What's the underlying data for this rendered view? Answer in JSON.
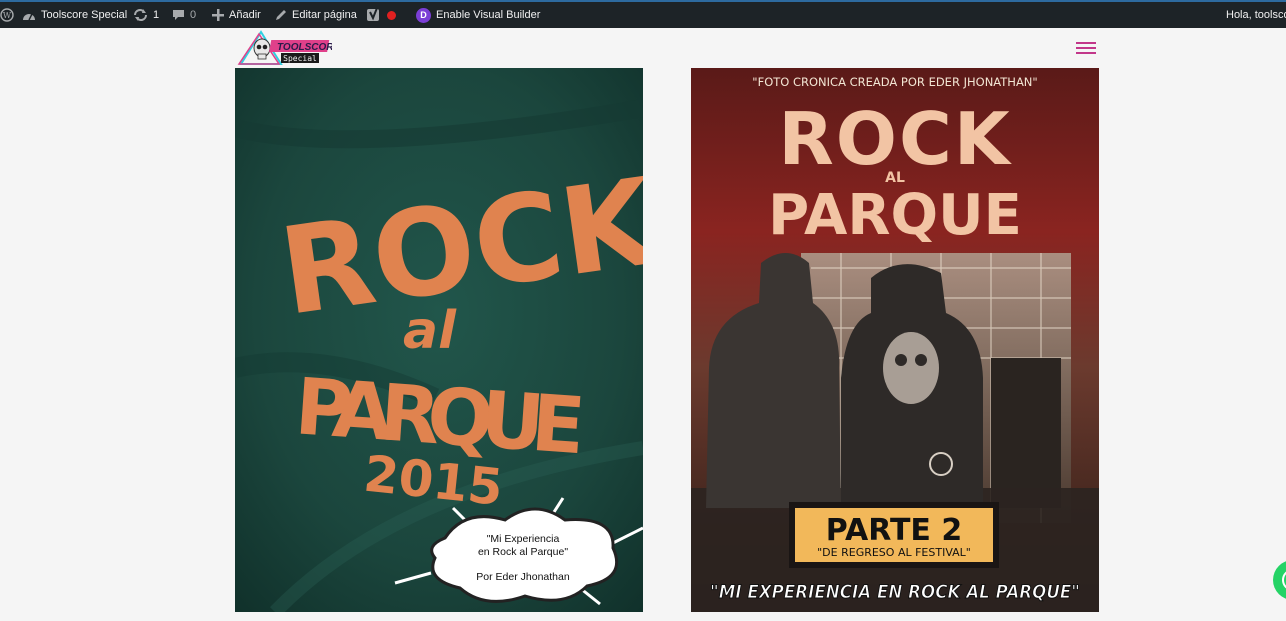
{
  "adminbar": {
    "site_name": "Toolscore Special",
    "updates_count": "1",
    "comments_count": "0",
    "add_label": "Añadir",
    "edit_label": "Editar página",
    "builder_label": "Enable Visual Builder",
    "greeting": "Hola, toolsco",
    "divi_letter": "D"
  },
  "logo": {
    "line1": "TOOLSCORE",
    "line2": "Special"
  },
  "poster_left": {
    "title_line1": "ROCK",
    "title_line2": "al",
    "title_line3": "PARQUE",
    "year": "2015",
    "bubble_line1": "\"Mi Experiencia",
    "bubble_line2": "en Rock al Parque\"",
    "bubble_line3": "Por Eder Jhonathan"
  },
  "poster_right": {
    "credit": "\"FOTO CRONICA CREADA POR EDER JHONATHAN\"",
    "title_line1": "ROCK",
    "title_line2": "AL",
    "title_line3": "PARQUE",
    "part_label": "PARTE 2",
    "part_sub": "\"DE REGRESO AL FESTIVAL\"",
    "bottom": "\"MI EXPERIENCIA EN ROCK AL PARQUE\""
  },
  "colors": {
    "adminbar_bg": "#1d2327",
    "menu_accent": "#c2378a",
    "poster_green": "#1e4a40",
    "poster_orange": "#e0834f",
    "poster_red": "#7a1f1c",
    "label_yellow": "#f2b85a"
  }
}
